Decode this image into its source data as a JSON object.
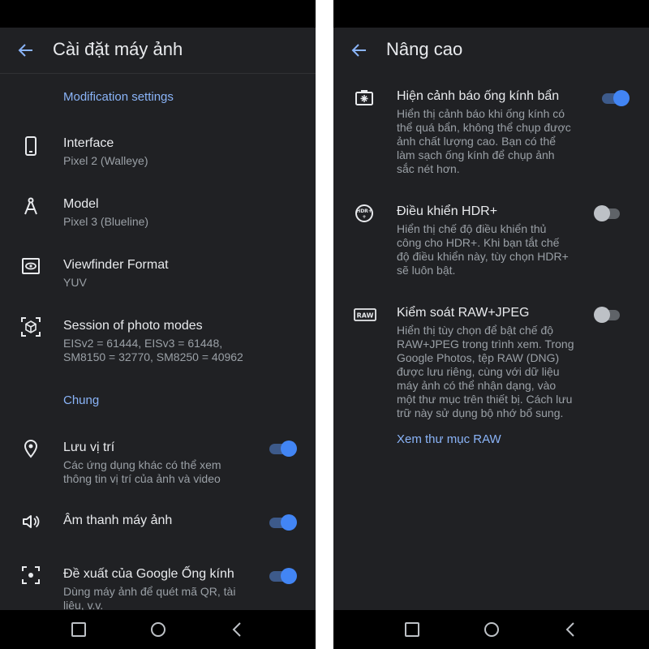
{
  "colors": {
    "background": "#202124",
    "accent": "#8ab4f8",
    "toggle_on": "#4285f4",
    "text": "#e8eaed",
    "secondary": "#9aa0a6"
  },
  "left": {
    "title": "Cài đặt máy ảnh",
    "section1": "Modification settings",
    "interface": {
      "title": "Interface",
      "subtitle": "Pixel 2 (Walleye)",
      "icon": "phone-icon"
    },
    "model": {
      "title": "Model",
      "subtitle": "Pixel 3 (Blueline)",
      "icon": "compass-icon"
    },
    "viewfinder": {
      "title": "Viewfinder Format",
      "subtitle": "YUV",
      "icon": "eye-icon"
    },
    "session": {
      "title": "Session of photo modes",
      "subtitle_line1": "EISv2 = 61444, EISv3 = 61448,",
      "subtitle_line2": "SM8150 = 32770, SM8250 = 40962",
      "icon": "cube-icon"
    },
    "section2": "Chung",
    "location": {
      "title": "Lưu vị trí",
      "subtitle_line1": "Các ứng dụng khác có thể xem",
      "subtitle_line2": "thông tin vị trí của ảnh và video",
      "icon": "location-icon",
      "enabled": true
    },
    "sound": {
      "title": "Âm thanh máy ảnh",
      "icon": "speaker-icon",
      "enabled": true
    },
    "lens": {
      "title": "Đề xuất của Google Ống kính",
      "subtitle_line1": "Dùng máy ảnh để quét mã QR, tài",
      "subtitle_line2": "liệu, v.v.",
      "icon": "lens-icon",
      "enabled": true
    }
  },
  "right": {
    "title": "Nâng cao",
    "dirty_lens": {
      "title": "Hiện cảnh báo ống kính bẩn",
      "lines": [
        "Hiển thị cảnh báo khi ống kính có",
        "thể quá bẩn, không thể chụp được",
        "ảnh chất lượng cao. Bạn có thể",
        "làm sạch ống kính để chụp ảnh",
        "sắc nét hơn."
      ],
      "icon": "dirty-lens-icon",
      "enabled": true
    },
    "hdr": {
      "title": "Điều khiển HDR+",
      "lines": [
        "Hiển thị chế độ điều khiển thủ",
        "công cho HDR+. Khi bạn tắt chế",
        "độ điều khiển này, tùy chọn HDR+",
        "sẽ luôn bật."
      ],
      "icon": "hdr-icon",
      "badge": "HDR+",
      "enabled": false
    },
    "raw": {
      "title": "Kiểm soát RAW+JPEG",
      "lines": [
        "Hiển thị tùy chọn để bật chế độ",
        "RAW+JPEG trong trình xem. Trong",
        "Google Photos, tệp RAW (DNG)",
        "được lưu riêng, cùng với dữ liệu",
        "máy ảnh có thể nhận dạng, vào",
        "một thư mục trên thiết bị. Cách lưu",
        "trữ này sử dụng bộ nhớ bổ sung."
      ],
      "icon": "raw-icon",
      "badge": "RAW",
      "enabled": false
    },
    "raw_link": "Xem thư mục RAW"
  }
}
